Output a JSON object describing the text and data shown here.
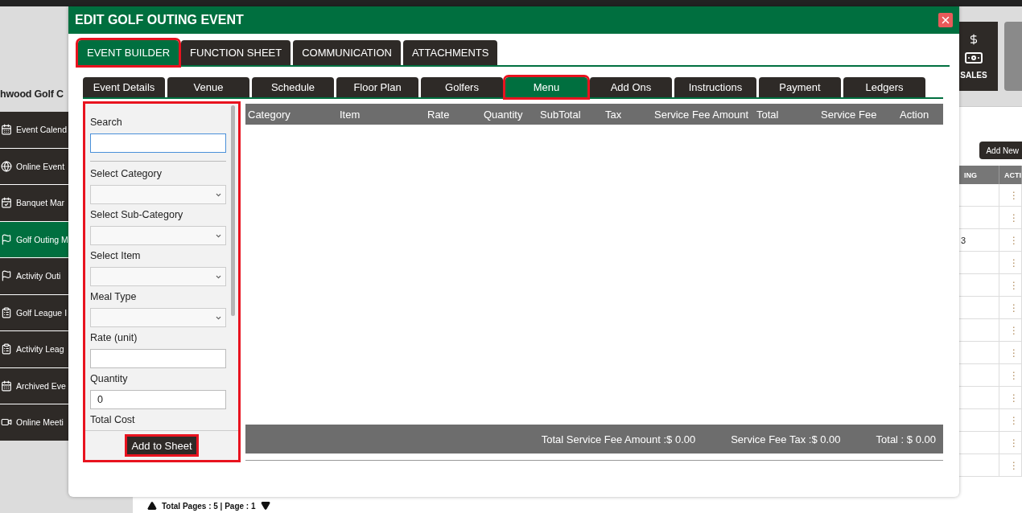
{
  "background": {
    "sidebar_title": "hwood Golf C",
    "sidebar": [
      {
        "label": "Event Calend",
        "selected": false
      },
      {
        "label": "Online Event",
        "selected": false
      },
      {
        "label": "Banquet Mar",
        "selected": false
      },
      {
        "label": "Golf Outing M",
        "selected": true
      },
      {
        "label": "Activity Outi",
        "selected": false
      },
      {
        "label": "Golf League I",
        "selected": false
      },
      {
        "label": "Activity Leag",
        "selected": false
      },
      {
        "label": "Archived Eve",
        "selected": false
      },
      {
        "label": "Online Meeti",
        "selected": false
      }
    ],
    "tiles": [
      {
        "label": "SALES"
      }
    ],
    "add_button": "Add New",
    "table": {
      "columns": [
        "ING",
        "ACTI"
      ],
      "rows": [
        {
          "action": "⋮"
        },
        {
          "action": "⋮"
        },
        {
          "col_ing": "3",
          "action": "⋮"
        },
        {
          "action": "⋮"
        },
        {
          "action": "⋮"
        },
        {
          "action": "⋮"
        },
        {
          "action": "⋮"
        },
        {
          "action": "⋮"
        },
        {
          "action": "⋮"
        },
        {
          "action": "⋮"
        },
        {
          "action": "⋮"
        },
        {
          "action": "⋮"
        },
        {
          "action": "⋮"
        }
      ]
    },
    "pager": "Total Pages : 5 | Page : 1"
  },
  "modal": {
    "title": "EDIT GOLF OUTING EVENT",
    "tabs": [
      {
        "label": "EVENT BUILDER",
        "selected": true,
        "highlighted": true
      },
      {
        "label": "FUNCTION SHEET",
        "selected": false,
        "highlighted": false
      },
      {
        "label": "COMMUNICATION",
        "selected": false,
        "highlighted": false
      },
      {
        "label": "ATTACHMENTS",
        "selected": false,
        "highlighted": false
      }
    ],
    "subtabs": [
      {
        "label": "Event Details",
        "selected": false,
        "highlighted": false
      },
      {
        "label": "Venue",
        "selected": false,
        "highlighted": false
      },
      {
        "label": "Schedule",
        "selected": false,
        "highlighted": false
      },
      {
        "label": "Floor Plan",
        "selected": false,
        "highlighted": false
      },
      {
        "label": "Golfers",
        "selected": false,
        "highlighted": false
      },
      {
        "label": "Menu",
        "selected": true,
        "highlighted": true
      },
      {
        "label": "Add Ons",
        "selected": false,
        "highlighted": false
      },
      {
        "label": "Instructions",
        "selected": false,
        "highlighted": false
      },
      {
        "label": "Payment",
        "selected": false,
        "highlighted": false
      },
      {
        "label": "Ledgers",
        "selected": false,
        "highlighted": false
      }
    ],
    "form": {
      "highlighted": true,
      "fields": [
        {
          "kind": "text",
          "label": "Search",
          "focused": true
        },
        {
          "kind": "select",
          "label": "Select Category",
          "focused": false
        },
        {
          "kind": "select",
          "label": "Select Sub-Category",
          "focused": false
        },
        {
          "kind": "select",
          "label": "Select Item",
          "focused": false
        },
        {
          "kind": "select",
          "label": "Meal Type",
          "focused": false
        },
        {
          "kind": "text",
          "label": "Rate (unit)",
          "focused": false
        },
        {
          "kind": "text",
          "label": "Quantity",
          "value": "0",
          "focused": false
        },
        {
          "kind": "label",
          "label": "Total Cost"
        }
      ],
      "add_button": {
        "label": "Add to Sheet",
        "highlighted": true
      }
    },
    "table": {
      "columns": [
        "Category",
        "Item",
        "Rate",
        "Quantity",
        "SubTotal",
        "Tax",
        "Service Fee Amount",
        "Total",
        "Service Fee",
        "Action"
      ]
    },
    "totals": [
      "Total Service Fee Amount :$ 0.00",
      "Service Fee Tax :$ 0.00",
      "Total : $ 0.00"
    ]
  }
}
